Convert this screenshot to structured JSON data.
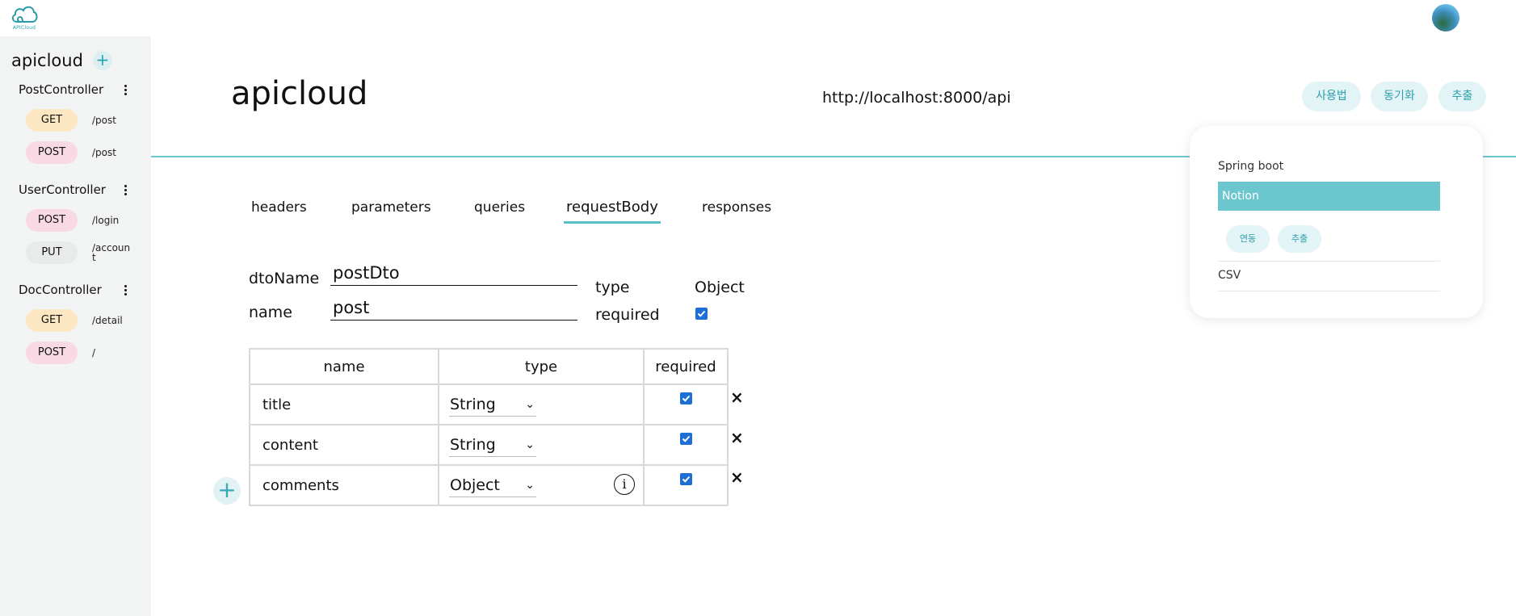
{
  "app": {
    "logo_text": "APICloud"
  },
  "sidebar": {
    "project_name": "apicloud",
    "project_add": "+",
    "controllers": [
      {
        "name": "PostController",
        "endpoints": [
          {
            "method": "GET",
            "path": "/post"
          },
          {
            "method": "POST",
            "path": "/post"
          }
        ]
      },
      {
        "name": "UserController",
        "endpoints": [
          {
            "method": "POST",
            "path": "/login"
          },
          {
            "method": "PUT",
            "path": "/account"
          }
        ]
      },
      {
        "name": "DocController",
        "endpoints": [
          {
            "method": "GET",
            "path": "/detail"
          },
          {
            "method": "POST",
            "path": "/"
          }
        ]
      }
    ]
  },
  "header": {
    "title": "apicloud",
    "base_url": "http://localhost:8000/api",
    "buttons": {
      "usage": "사용법",
      "sync": "동기화",
      "export": "추출"
    }
  },
  "tabs": [
    "headers",
    "parameters",
    "queries",
    "requestBody",
    "responses"
  ],
  "active_tab": "requestBody",
  "form": {
    "dto_label": "dtoName",
    "dto_value": "postDto",
    "name_label": "name",
    "name_value": "post",
    "type_label": "type",
    "type_value": "Object",
    "required_label": "required",
    "required_checked": true
  },
  "table": {
    "headers": [
      "name",
      "type",
      "required"
    ],
    "rows": [
      {
        "name": "title",
        "type": "String",
        "required": true,
        "info": false
      },
      {
        "name": "content",
        "type": "String",
        "required": true,
        "info": false
      },
      {
        "name": "comments",
        "type": "Object",
        "required": true,
        "info": true
      }
    ],
    "delete_symbol": "×",
    "info_symbol": "i",
    "add_row_symbol": "+"
  },
  "export_menu": {
    "options": [
      "Spring boot",
      "Notion",
      "CSV"
    ],
    "selected": "Notion",
    "buttons": {
      "link": "연동",
      "export": "추출"
    }
  }
}
